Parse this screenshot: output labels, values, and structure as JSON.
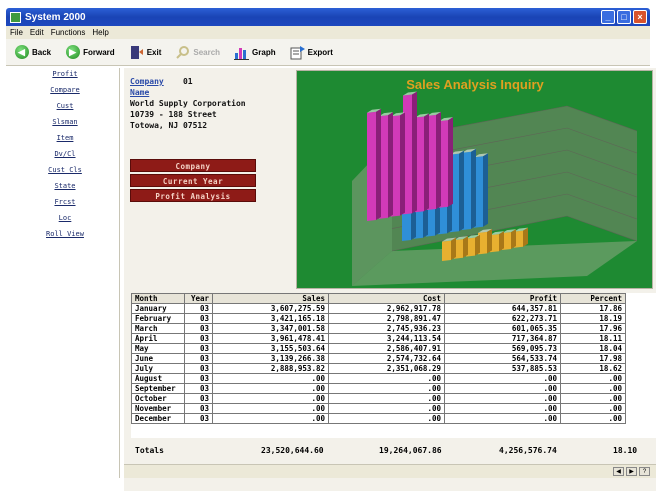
{
  "window": {
    "title": "System 2000"
  },
  "menu": [
    "File",
    "Edit",
    "Functions",
    "Help"
  ],
  "toolbar": {
    "back": "Back",
    "forward": "Forward",
    "exit": "Exit",
    "search": "Search",
    "graph": "Graph",
    "export": "Export"
  },
  "sidebar": {
    "items": [
      "Profit",
      "Compare",
      "Cust",
      "Slsman",
      "Item",
      "Dv/Cl",
      "Cust Cls",
      "State",
      "Frcst",
      "Loc",
      "Roll View"
    ]
  },
  "company": {
    "label": "Company",
    "number": "01",
    "name_label": "Name",
    "name": "World Supply Corporation",
    "address1": "10739 - 188 Street",
    "address2": "Totowa, NJ 07512"
  },
  "buttons": {
    "company": "Company",
    "current_year": "Current Year",
    "profit_analysis": "Profit Analysis"
  },
  "chart": {
    "title": "Sales Analysis Inquiry",
    "colors": {
      "background": "#1e8a32",
      "title": "#e0a020",
      "sales": "#d23ab8",
      "cost": "#2f8fd8",
      "profit": "#e8b030"
    }
  },
  "chart_data": {
    "type": "bar",
    "title": "Sales Analysis Inquiry",
    "categories": [
      "January",
      "February",
      "March",
      "April",
      "May",
      "June",
      "July",
      "August",
      "September",
      "October",
      "November",
      "December"
    ],
    "series": [
      {
        "name": "Sales",
        "values": [
          3607275.59,
          3421165.18,
          3347001.58,
          3961478.41,
          3155503.64,
          3139266.38,
          2888953.82,
          0,
          0,
          0,
          0,
          0
        ]
      },
      {
        "name": "Cost",
        "values": [
          2962917.78,
          2798891.47,
          2745936.23,
          3244113.54,
          2586407.91,
          2574732.64,
          2351068.29,
          0,
          0,
          0,
          0,
          0
        ]
      },
      {
        "name": "Profit",
        "values": [
          644357.81,
          622273.71,
          601065.35,
          717364.87,
          569095.73,
          564533.74,
          537885.53,
          0,
          0,
          0,
          0,
          0
        ]
      }
    ]
  },
  "table": {
    "headers": [
      "Month",
      "Year",
      "Sales",
      "Cost",
      "Profit",
      "Percent"
    ],
    "rows": [
      [
        "January",
        "03",
        "3,607,275.59",
        "2,962,917.78",
        "644,357.81",
        "17.86"
      ],
      [
        "February",
        "03",
        "3,421,165.18",
        "2,798,891.47",
        "622,273.71",
        "18.19"
      ],
      [
        "March",
        "03",
        "3,347,001.58",
        "2,745,936.23",
        "601,065.35",
        "17.96"
      ],
      [
        "April",
        "03",
        "3,961,478.41",
        "3,244,113.54",
        "717,364.87",
        "18.11"
      ],
      [
        "May",
        "03",
        "3,155,503.64",
        "2,586,407.91",
        "569,095.73",
        "18.04"
      ],
      [
        "June",
        "03",
        "3,139,266.38",
        "2,574,732.64",
        "564,533.74",
        "17.98"
      ],
      [
        "July",
        "03",
        "2,888,953.82",
        "2,351,068.29",
        "537,885.53",
        "18.62"
      ],
      [
        "August",
        "03",
        ".00",
        ".00",
        ".00",
        ".00"
      ],
      [
        "September",
        "03",
        ".00",
        ".00",
        ".00",
        ".00"
      ],
      [
        "October",
        "03",
        ".00",
        ".00",
        ".00",
        ".00"
      ],
      [
        "November",
        "03",
        ".00",
        ".00",
        ".00",
        ".00"
      ],
      [
        "December",
        "03",
        ".00",
        ".00",
        ".00",
        ".00"
      ]
    ]
  },
  "totals": {
    "label": "Totals",
    "sales": "23,520,644.60",
    "cost": "19,264,067.86",
    "profit": "4,256,576.74",
    "percent": "18.10"
  }
}
